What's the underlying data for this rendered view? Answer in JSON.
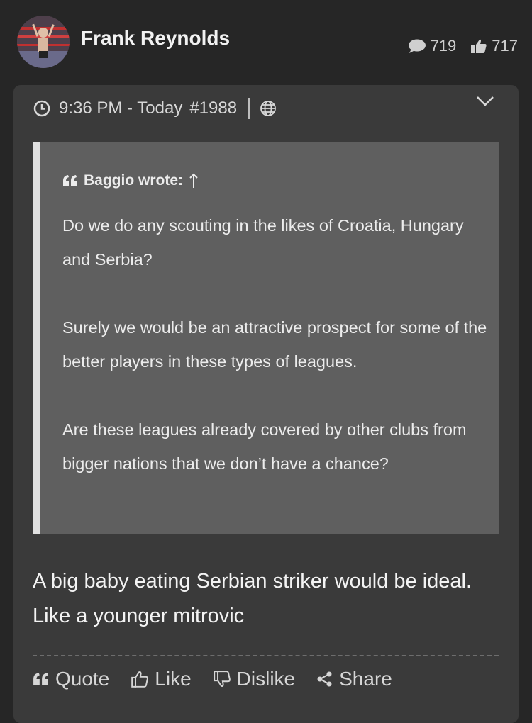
{
  "post": {
    "author": "Frank Reynolds",
    "messages_count": "719",
    "likes_count": "717",
    "time": "9:36 PM - Today",
    "post_number": "#1988"
  },
  "quote": {
    "author_label": "Baggio wrote:",
    "paragraphs": [
      "Do we do any scouting in the likes of Croatia, Hungary and Serbia?",
      "Surely we would be an attractive prospect for some of the better players in these types of leagues.",
      "Are these leagues already covered by other clubs from bigger nations that we don’t have a chance?"
    ]
  },
  "reply_text": "A big baby eating Serbian striker would be ideal. Like a younger mitrovic",
  "actions": {
    "quote": "Quote",
    "like": "Like",
    "dislike": "Dislike",
    "share": "Share"
  },
  "icons": {
    "messages": "speech-bubble-icon",
    "likes": "thumbs-up-icon",
    "time": "clock-icon",
    "visibility": "globe-icon",
    "expand": "chevron-down-icon",
    "quote": "quote-marks-icon",
    "dislike": "thumbs-down-icon",
    "share": "share-icon"
  }
}
